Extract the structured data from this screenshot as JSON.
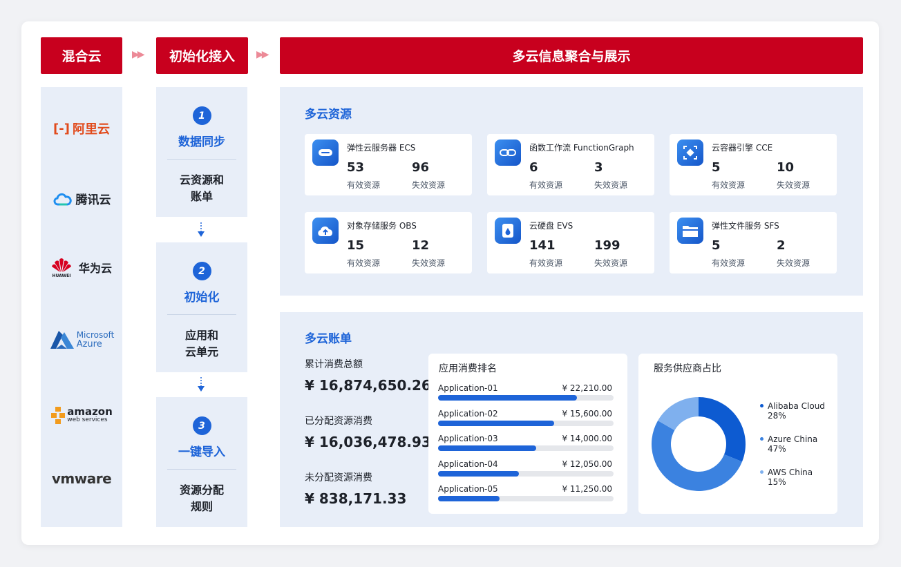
{
  "header": {
    "hybrid_cloud": "混合云",
    "init_access": "初始化接入",
    "aggregation": "多云信息聚合与展示",
    "arrow_glyph": "▶▶"
  },
  "providers": [
    {
      "name": "阿里云",
      "icon": "alibaba-cloud-logo",
      "color": "#e14a1c"
    },
    {
      "name": "腾讯云",
      "icon": "tencent-cloud-logo",
      "color": "#1d2129"
    },
    {
      "name": "华为云",
      "icon": "huawei-cloud-logo",
      "mark": "HUAWEI",
      "color": "#d7001f"
    },
    {
      "name": "Microsoft",
      "name2": "Azure",
      "icon": "azure-logo",
      "color": "#2a6bbd"
    },
    {
      "name": "amazon",
      "name2": "web services",
      "icon": "aws-logo",
      "color": "#1d2129"
    },
    {
      "name": "vmware",
      "icon": "vmware-logo",
      "color": "#333333"
    }
  ],
  "steps": [
    {
      "num": "1",
      "title": "数据同步",
      "desc1": "云资源和",
      "desc2": "账单"
    },
    {
      "num": "2",
      "title": "初始化",
      "desc1": "应用和",
      "desc2": "云单元"
    },
    {
      "num": "3",
      "title": "一键导入",
      "desc1": "资源分配",
      "desc2": "规则"
    }
  ],
  "resources": {
    "title": "多云资源",
    "valid_label": "有效资源",
    "invalid_label": "失效资源",
    "items": [
      {
        "name": "弹性云服务器 ECS",
        "valid": "53",
        "invalid": "96",
        "icon": "server-icon"
      },
      {
        "name": "函数工作流 FunctionGraph",
        "valid": "6",
        "invalid": "3",
        "icon": "link-icon"
      },
      {
        "name": "云容器引擎 CCE",
        "valid": "5",
        "invalid": "10",
        "icon": "container-icon"
      },
      {
        "name": "对象存储服务 OBS",
        "valid": "15",
        "invalid": "12",
        "icon": "cloud-upload-icon"
      },
      {
        "name": "云硬盘 EVS",
        "valid": "141",
        "invalid": "199",
        "icon": "disk-icon"
      },
      {
        "name": "弹性文件服务 SFS",
        "valid": "5",
        "invalid": "2",
        "icon": "folder-icon"
      }
    ]
  },
  "billing": {
    "title": "多云账单",
    "totals": [
      {
        "label": "累计消费总额",
        "value": "¥ 16,874,650.26"
      },
      {
        "label": "已分配资源消费",
        "value": "¥ 16,036,478.93"
      },
      {
        "label": "未分配资源消费",
        "value": "¥ 838,171.33"
      }
    ],
    "ranking": {
      "title": "应用消费排名",
      "items": [
        {
          "name": "Application-01",
          "value": "¥ 22,210.00",
          "fraction": 0.79
        },
        {
          "name": "Application-02",
          "value": "¥ 15,600.00",
          "fraction": 0.66
        },
        {
          "name": "Application-03",
          "value": "¥ 14,000.00",
          "fraction": 0.56
        },
        {
          "name": "Application-04",
          "value": "¥ 12,050.00",
          "fraction": 0.46
        },
        {
          "name": "Application-05",
          "value": "¥ 11,250.00",
          "fraction": 0.35
        }
      ]
    },
    "share": {
      "title": "服务供应商占比",
      "items": [
        {
          "name": "Alibaba Cloud",
          "pct": "28%",
          "value": 28,
          "color": "#0d5bd1"
        },
        {
          "name": "Azure China",
          "pct": "47%",
          "value": 47,
          "color": "#3b82e0"
        },
        {
          "name": "AWS China",
          "pct": "15%",
          "value": 15,
          "color": "#7fb0ee"
        }
      ]
    }
  },
  "colors": {
    "brand_red": "#c8001e",
    "accent_blue": "#1e64d8",
    "panel_bg": "#e8eef8"
  }
}
